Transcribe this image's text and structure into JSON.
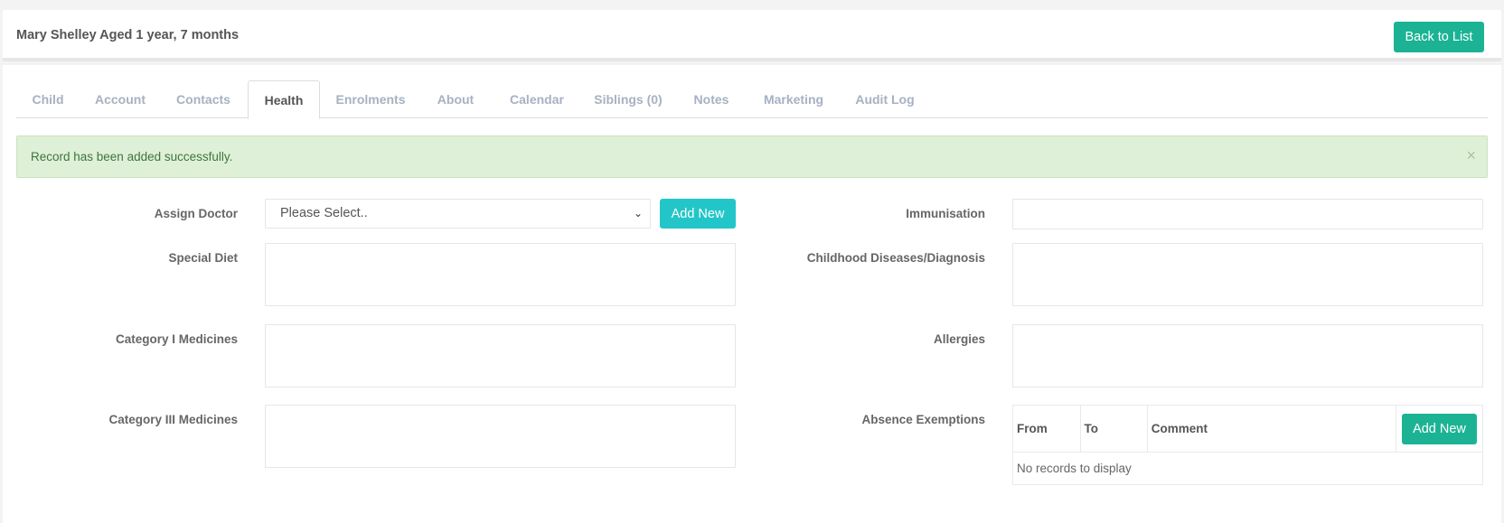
{
  "header": {
    "title": "Mary Shelley Aged 1 year, 7 months",
    "back_label": "Back to List"
  },
  "tabs": [
    {
      "label": "Child",
      "active": false
    },
    {
      "label": "Account",
      "active": false
    },
    {
      "label": "Contacts",
      "active": false
    },
    {
      "label": "Health",
      "active": true
    },
    {
      "label": "Enrolments",
      "active": false
    },
    {
      "label": "About",
      "active": false
    },
    {
      "label": "Calendar",
      "active": false
    },
    {
      "label": "Siblings (0)",
      "active": false
    },
    {
      "label": "Notes",
      "active": false
    },
    {
      "label": "Marketing",
      "active": false
    },
    {
      "label": "Audit Log",
      "active": false
    }
  ],
  "alert": {
    "message": "Record has been added successfully.",
    "close_glyph": "×"
  },
  "form": {
    "assign_doctor_label": "Assign Doctor",
    "assign_doctor_value": "Please Select..",
    "add_new_label": "Add New",
    "special_diet_label": "Special Diet",
    "category1_label": "Category I Medicines",
    "category3_label": "Category III Medicines",
    "immunisation_label": "Immunisation",
    "childhood_label": "Childhood Diseases/Diagnosis",
    "allergies_label": "Allergies",
    "absence_label": "Absence Exemptions"
  },
  "absence_table": {
    "columns": [
      "From",
      "To",
      "Comment"
    ],
    "add_new_label": "Add New",
    "empty_text": "No records to display"
  },
  "colors": {
    "primary": "#1bb394",
    "info": "#23c6c8",
    "alert_bg": "#dff0d8"
  }
}
